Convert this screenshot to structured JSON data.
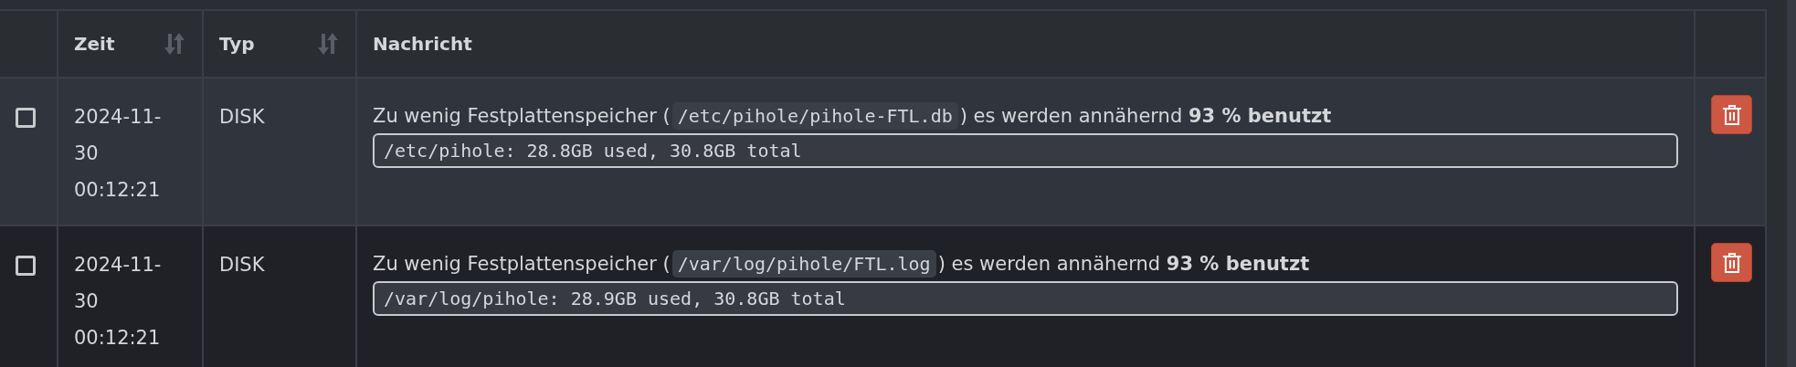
{
  "table": {
    "columns": [
      {
        "sortable": false
      },
      {
        "label": "Zeit",
        "sortable": true
      },
      {
        "label": "Typ",
        "sortable": true
      },
      {
        "label": "Nachricht",
        "sortable": false
      },
      {
        "sortable": false
      }
    ],
    "rows": [
      {
        "checked": false,
        "time": [
          "2024-11-",
          "30",
          "00:12:21"
        ],
        "type": "DISK",
        "message_before": "Zu wenig Festplattenspeicher (",
        "path": "/etc/pihole/pihole-FTL.db",
        "message_after": ") es werden annähernd **93 % benutzt**",
        "detail": "/etc/pihole: 28.8GB used, 30.8GB total"
      },
      {
        "checked": false,
        "time": [
          "2024-11-",
          "30",
          "00:12:21"
        ],
        "type": "DISK",
        "message_before": "Zu wenig Festplattenspeicher (",
        "path": "/var/log/pihole/FTL.log",
        "message_after": ") es werden annähernd **93 % benutzt**",
        "detail": "/var/log/pihole: 28.9GB used, 30.8GB total"
      }
    ]
  }
}
